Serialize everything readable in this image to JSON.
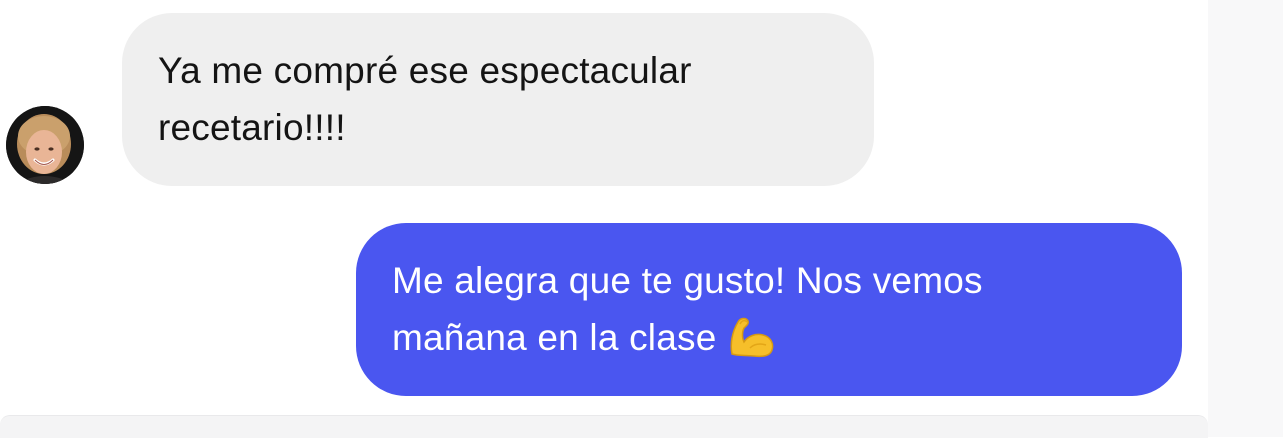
{
  "conversation": {
    "messages": [
      {
        "direction": "incoming",
        "lines": [
          "Ya me compré ese espectacular",
          "recetario!!!!"
        ],
        "has_avatar": true,
        "bubble_color": "#efefef",
        "text_color": "#141414"
      },
      {
        "direction": "outgoing",
        "lines": [
          "Me alegra que te gusto! Nos vemos",
          "mañana en la clase"
        ],
        "emoji": "flexed-biceps-icon",
        "bubble_color": "#4a56f0",
        "text_color": "#ffffff"
      }
    ]
  },
  "avatar": {
    "icon": "contact-avatar-photo"
  }
}
